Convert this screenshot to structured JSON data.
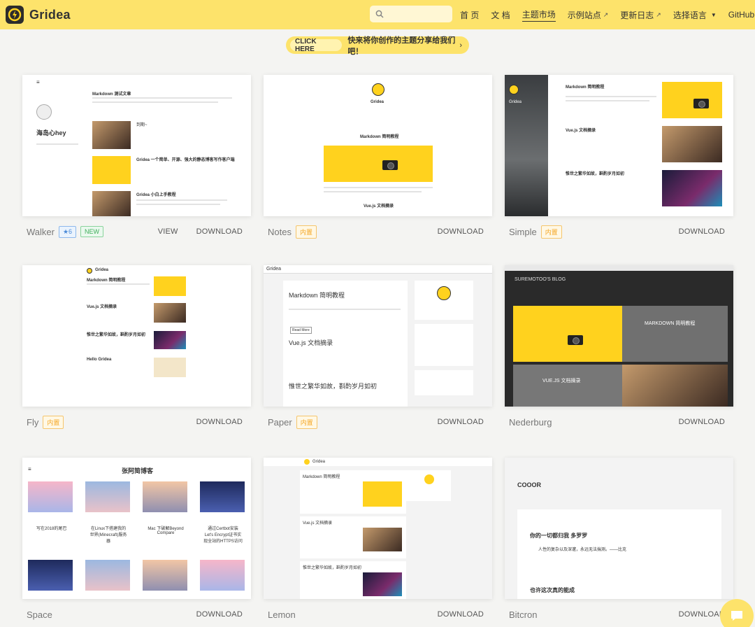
{
  "header": {
    "brand": "Gridea",
    "search_placeholder": "",
    "nav": [
      {
        "label": "首 页",
        "external": false,
        "active": false
      },
      {
        "label": "文 档",
        "external": false,
        "active": false
      },
      {
        "label": "主题市场",
        "external": false,
        "active": true
      },
      {
        "label": "示例站点",
        "external": true,
        "active": false
      },
      {
        "label": "更新日志",
        "external": true,
        "active": false
      },
      {
        "label": "选择语言",
        "external": false,
        "active": false,
        "dropdown": true
      },
      {
        "label": "GitHub",
        "external": true,
        "active": false
      }
    ]
  },
  "banner": {
    "button": "CLICK HERE",
    "text": "快来将你创作的主题分享给我们吧！",
    "arrow": "›"
  },
  "themes": [
    {
      "name": "Walker",
      "tags": [
        {
          "text": "★6",
          "kind": "stars"
        },
        {
          "text": "NEW",
          "kind": "new"
        }
      ],
      "actions": [
        "VIEW",
        "DOWNLOAD"
      ]
    },
    {
      "name": "Notes",
      "tags": [
        {
          "text": "内置",
          "kind": "builtin"
        }
      ],
      "actions": [
        "DOWNLOAD"
      ]
    },
    {
      "name": "Simple",
      "tags": [
        {
          "text": "内置",
          "kind": "builtin"
        }
      ],
      "actions": [
        "DOWNLOAD"
      ]
    },
    {
      "name": "Fly",
      "tags": [
        {
          "text": "内置",
          "kind": "builtin"
        }
      ],
      "actions": [
        "DOWNLOAD"
      ]
    },
    {
      "name": "Paper",
      "tags": [
        {
          "text": "内置",
          "kind": "builtin"
        }
      ],
      "actions": [
        "DOWNLOAD"
      ]
    },
    {
      "name": "Nederburg",
      "tags": [],
      "actions": [
        "DOWNLOAD"
      ]
    },
    {
      "name": "Space",
      "tags": [],
      "actions": [
        "DOWNLOAD"
      ]
    },
    {
      "name": "Lemon",
      "tags": [],
      "actions": [
        "DOWNLOAD"
      ]
    },
    {
      "name": "Bitcron",
      "tags": [],
      "actions": [
        "DOWNLOAD"
      ]
    }
  ],
  "previews": {
    "walker": {
      "author": "海岛心hey",
      "post1": "Markdown 测试文章",
      "post2": "Gridea 一个简单、开源、强大的静态博客写作客户端",
      "post3": "Gridea 小白上手教程",
      "post4": "到期~"
    },
    "notes": {
      "brand": "Gridea",
      "post1": "Markdown 简明教程",
      "post2": "Vue.js 文档摘录"
    },
    "simple": {
      "brand": "Gridea",
      "post1": "Markdown 简明教程",
      "post2": "Vue.js 文档摘录",
      "post3": "惟世之繁华如故，斟酌岁月如初"
    },
    "fly": {
      "brand": "Gridea",
      "post1": "Markdown 简明教程",
      "post2": "Vue.js 文档摘录",
      "post3": "惟世之繁华如故，斟酌岁月如初",
      "post4": "Hello Gridea"
    },
    "paper": {
      "brand": "Gridea",
      "post1": "Markdown 简明教程",
      "post2": "Vue.js 文档摘录",
      "post3": "惟世之繁华如故，斟酌岁月如初",
      "button": "Read More"
    },
    "nederburg": {
      "brand": "SUREMOTOO'S BLOG",
      "post1": "MARKDOWN 简明教程",
      "post2": "VUE.JS 文档摘录"
    },
    "space": {
      "brand": "张阿简博客",
      "post1": "写在2018的尾巴",
      "post2": "在Linux下搭建我的世界(Minecraft)服务器",
      "post3": "Mac 下破解Beyond Compare",
      "post4": "通过Certbot安装Let's Encrypt证书实现全站的HTTPS访问"
    },
    "lemon": {
      "brand": "Gridea",
      "post1": "Markdown 简明教程",
      "post2": "Vue.js 文档摘录",
      "post3": "惟世之繁华如故，斟酌岁月如初"
    },
    "bitcron": {
      "brand": "COOOR",
      "quote": "你的一切都归我 多罗罗",
      "sub": "人性的复杂以及深邃，永远无法揣测。——比克",
      "post2": "也许这次真的能成"
    }
  },
  "chat": {
    "icon": "chat-icon"
  }
}
